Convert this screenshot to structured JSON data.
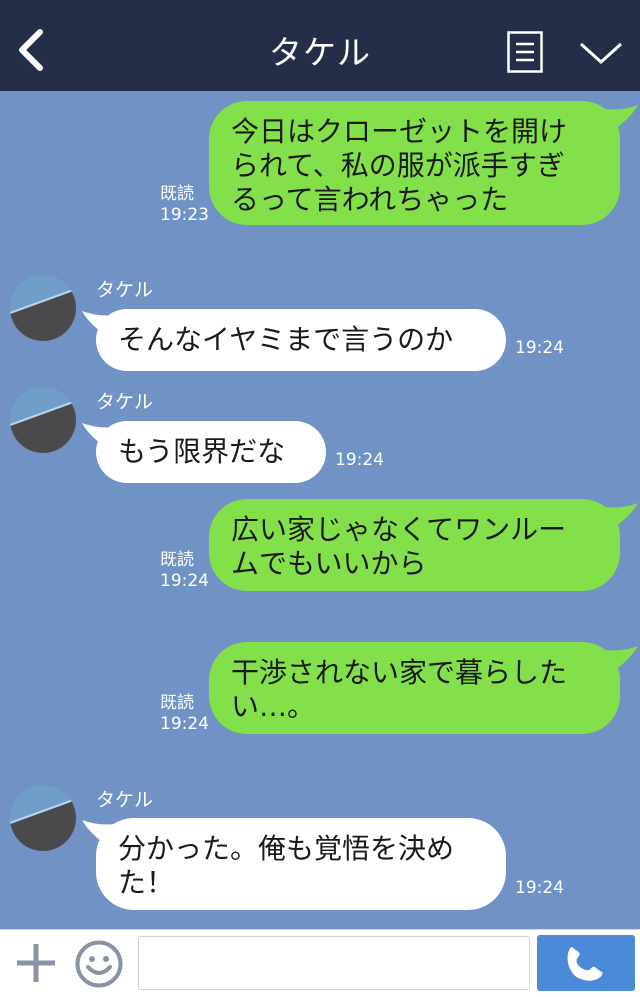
{
  "header": {
    "title": "タケル"
  },
  "messages": [
    {
      "dir": "out",
      "lines": [
        "今日はクローゼットを開け",
        "られて、私の服が派手すぎ",
        "るって言われちゃった"
      ],
      "read": "既読",
      "time": "19:23"
    },
    {
      "dir": "in",
      "sender": "タケル",
      "lines": [
        "そんなイヤミまで言うのか"
      ],
      "time": "19:24"
    },
    {
      "dir": "in",
      "sender": "タケル",
      "lines": [
        "もう限界だな"
      ],
      "time": "19:24"
    },
    {
      "dir": "out",
      "lines": [
        "広い家じゃなくてワンルー",
        "ムでもいいから"
      ],
      "read": "既読",
      "time": "19:24"
    },
    {
      "dir": "out",
      "lines": [
        "干渉されない家で暮らした",
        "い…。"
      ],
      "read": "既読",
      "time": "19:24"
    },
    {
      "dir": "in",
      "sender": "タケル",
      "lines": [
        "分かった。俺も覚悟を決め",
        "た！"
      ],
      "time": "19:24"
    }
  ],
  "composer": {
    "input_value": ""
  },
  "colors": {
    "header": "#252e48",
    "background": "#7092c4",
    "outgoing_bubble": "#84e04a",
    "incoming_bubble": "#ffffff",
    "call_button": "#4a8ad8"
  }
}
